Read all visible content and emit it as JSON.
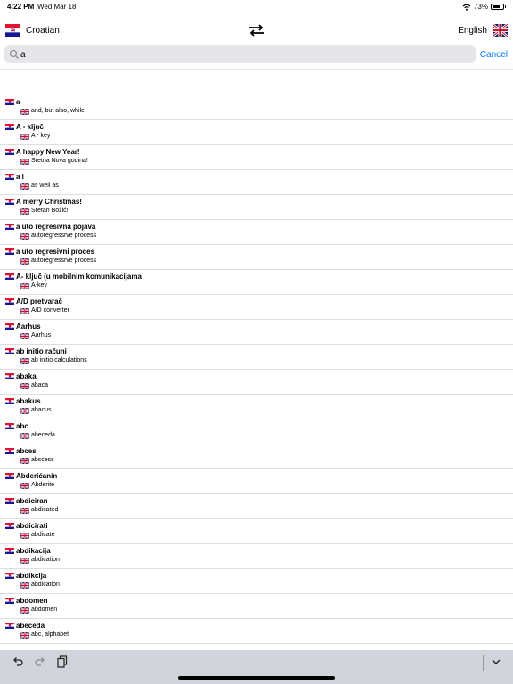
{
  "status_bar": {
    "time": "4:22 PM",
    "date": "Wed Mar 18",
    "battery_percent": "73%",
    "battery_level": 73
  },
  "header": {
    "source_language": "Croatian",
    "target_language": "English"
  },
  "search": {
    "query": "a",
    "cancel_label": "Cancel"
  },
  "entries": [
    {
      "term": "a",
      "translation": "and, but also, while"
    },
    {
      "term": "A - ključ",
      "translation": "A - key"
    },
    {
      "term": "A happy New Year!",
      "translation": "Sretna Nova godina!"
    },
    {
      "term": "a i",
      "translation": "as well as"
    },
    {
      "term": "A merry Christmas!",
      "translation": "Sretan Božić!"
    },
    {
      "term": "a uto regresivna pojava",
      "translation": "autoregressrve process"
    },
    {
      "term": "a uto regresivni proces",
      "translation": "autoregressrve process"
    },
    {
      "term": "A- ključ (u mobilnim komunikacijama",
      "translation": "A-key"
    },
    {
      "term": "A/D pretvarač",
      "translation": "A/D converter"
    },
    {
      "term": "Aarhus",
      "translation": "Aarhus"
    },
    {
      "term": "ab initio računi",
      "translation": "ab initio calculations"
    },
    {
      "term": "abaka",
      "translation": "abaca"
    },
    {
      "term": "abakus",
      "translation": "abacus"
    },
    {
      "term": "abc",
      "translation": "abeceda"
    },
    {
      "term": "abces",
      "translation": "abscess"
    },
    {
      "term": "Abderićanin",
      "translation": "Abderite"
    },
    {
      "term": "abdiciran",
      "translation": "abdicated"
    },
    {
      "term": "abdicirati",
      "translation": "abdicate"
    },
    {
      "term": "abdikacija",
      "translation": "abdication"
    },
    {
      "term": "abdikcija",
      "translation": "abdication"
    },
    {
      "term": "abdomen",
      "translation": "abdomen"
    },
    {
      "term": "abeceda",
      "translation": "abc, alphabet"
    }
  ],
  "icons": {
    "source_flag": "croatia-flag-icon",
    "target_flag": "uk-flag-icon",
    "swap": "swap-arrows-icon",
    "search": "magnifier-icon",
    "undo": "undo-icon",
    "redo": "redo-icon",
    "paste": "clipboard-icon",
    "dismiss_keyboard": "chevron-down-icon"
  },
  "colors": {
    "accent": "#0a7aff",
    "search_field": "#e5e5ea",
    "toolbar": "#d1d4da"
  }
}
